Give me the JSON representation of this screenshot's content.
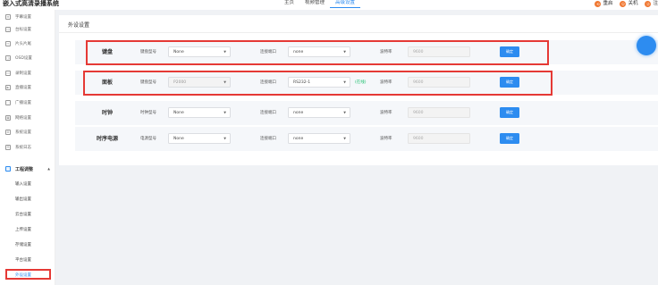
{
  "header": {
    "app_title": "嵌入式高清录播系统",
    "nav": [
      "主页",
      "视频管理",
      "高级设置"
    ],
    "active_nav": 2,
    "actions": [
      {
        "label": "重启",
        "icon": "restart-icon",
        "color": "#f07832"
      },
      {
        "label": "关机",
        "icon": "power-icon",
        "color": "#f07832"
      },
      {
        "label": "注",
        "icon": "logout-icon",
        "color": "#f07832"
      }
    ]
  },
  "sidebar": {
    "items": [
      {
        "label": "字幕设置",
        "icon": "subtitle-icon"
      },
      {
        "label": "台标设置",
        "icon": "logo-icon"
      },
      {
        "label": "片头片尾",
        "icon": "clip-icon"
      },
      {
        "label": "OSD设置",
        "icon": "osd-icon"
      },
      {
        "label": "录制设置",
        "icon": "record-icon"
      },
      {
        "label": "直播设置",
        "icon": "live-icon"
      },
      {
        "label": "广播设置",
        "icon": "broadcast-icon"
      },
      {
        "label": "网络设置",
        "icon": "network-icon"
      },
      {
        "label": "系统设置",
        "icon": "system-icon"
      },
      {
        "label": "系统日志",
        "icon": "log-icon"
      }
    ],
    "group": {
      "label": "工程调整",
      "arrow": "▲"
    },
    "sub_items": [
      "输入设置",
      "输出设置",
      "云台设置",
      "上传设置",
      "存储设置",
      "平台设置",
      "外设设置"
    ],
    "active_sub": 6
  },
  "panel": {
    "title": "外设设置",
    "rows": [
      {
        "label": "键盘",
        "type_label": "键盘型号",
        "type_value": "None",
        "port_label": "连接端口",
        "port_value": "none",
        "status": "",
        "baud_label": "波特率",
        "baud_value": "9600",
        "button": "确定",
        "type_disabled": false
      },
      {
        "label": "面板",
        "type_label": "键盘型号",
        "type_value": "P2000",
        "port_label": "连接端口",
        "port_value": "RS232-1",
        "status": "(在线)",
        "baud_label": "波特率",
        "baud_value": "9600",
        "button": "确定",
        "type_disabled": true
      },
      {
        "label": "时钟",
        "type_label": "时钟型号",
        "type_value": "None",
        "port_label": "连接端口",
        "port_value": "none",
        "status": "",
        "baud_label": "波特率",
        "baud_value": "9600",
        "button": "确定",
        "type_disabled": false
      },
      {
        "label": "时序电源",
        "type_label": "电源型号",
        "type_value": "None",
        "port_label": "连接端口",
        "port_value": "none",
        "status": "",
        "baud_label": "波特率",
        "baud_value": "9600",
        "button": "确定",
        "type_disabled": false
      }
    ]
  }
}
